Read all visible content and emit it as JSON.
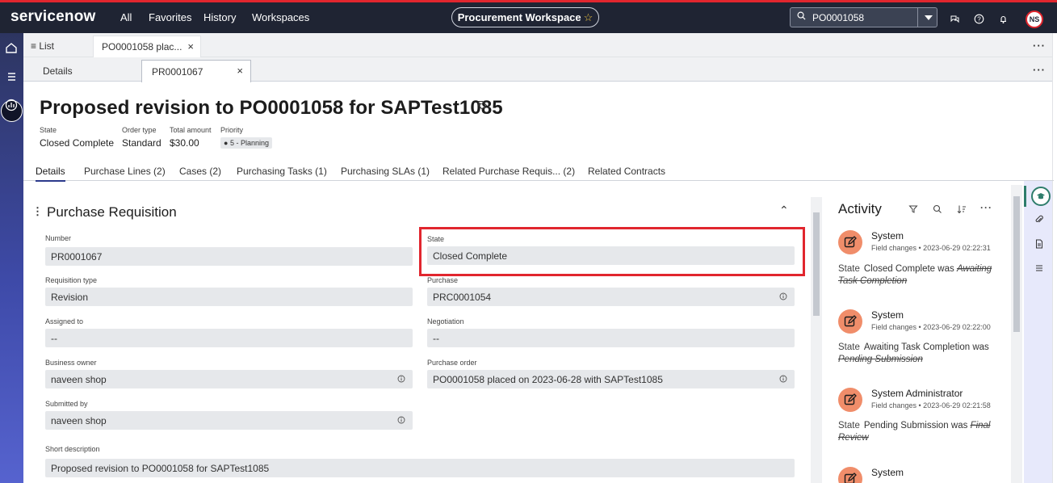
{
  "topbar": {
    "logo": "servicenow",
    "nav": [
      "All",
      "Favorites",
      "History",
      "Workspaces"
    ],
    "workspace_button": "Procurement Workspace",
    "search_value": "PO0001058",
    "avatar_initials": "NS",
    "colors": {
      "bar": "#1f2433",
      "accent": "#e1262e"
    }
  },
  "tabs_primary": {
    "list_label": "List",
    "record_tab": "PO0001058 plac..."
  },
  "tabs_secondary": {
    "details_label": "Details",
    "record_tab": "PR0001067"
  },
  "record": {
    "title": "Proposed revision to PO0001058 for SAPTest1085",
    "meta": {
      "state_label": "State",
      "state_value": "Closed Complete",
      "order_type_label": "Order type",
      "order_type_value": "Standard",
      "total_label": "Total amount",
      "total_value": "$30.00",
      "priority_label": "Priority",
      "priority_value": "5 - Planning"
    }
  },
  "subtabs": [
    "Details",
    "Purchase Lines (2)",
    "Cases (2)",
    "Purchasing Tasks (1)",
    "Purchasing SLAs (1)",
    "Related Purchase Requis... (2)",
    "Related Contracts"
  ],
  "form": {
    "section_title": "Purchase Requisition",
    "fields": {
      "number": {
        "label": "Number",
        "value": "PR0001067"
      },
      "state": {
        "label": "State",
        "value": "Closed Complete"
      },
      "requisition_type": {
        "label": "Requisition type",
        "value": "Revision"
      },
      "purchase": {
        "label": "Purchase",
        "value": "PRC0001054"
      },
      "assigned_to": {
        "label": "Assigned to",
        "value": "--"
      },
      "negotiation": {
        "label": "Negotiation",
        "value": "--"
      },
      "business_owner": {
        "label": "Business owner",
        "value": "naveen shop"
      },
      "purchase_order": {
        "label": "Purchase order",
        "value": "PO0001058 placed on 2023-06-28 with SAPTest1085"
      },
      "submitted_by": {
        "label": "Submitted by",
        "value": "naveen shop"
      },
      "short_description": {
        "label": "Short description",
        "value": "Proposed revision to PO0001058 for SAPTest1085"
      }
    }
  },
  "activity": {
    "title": "Activity",
    "entries": [
      {
        "who": "System",
        "meta": "Field changes • 2023-06-29 02:22:31",
        "field": "State",
        "new": "Closed Complete",
        "was": "was",
        "old": "Awaiting Task Completion"
      },
      {
        "who": "System",
        "meta": "Field changes • 2023-06-29 02:22:00",
        "field": "State",
        "new": "Awaiting Task Completion",
        "was": "was",
        "old": "Pending Submission"
      },
      {
        "who": "System Administrator",
        "meta": "Field changes • 2023-06-29 02:21:58",
        "field": "State",
        "new": "Pending Submission",
        "was": "was",
        "old": "Final Review"
      },
      {
        "who": "System",
        "meta": "",
        "field": "",
        "new": "",
        "was": "",
        "old": ""
      }
    ]
  }
}
